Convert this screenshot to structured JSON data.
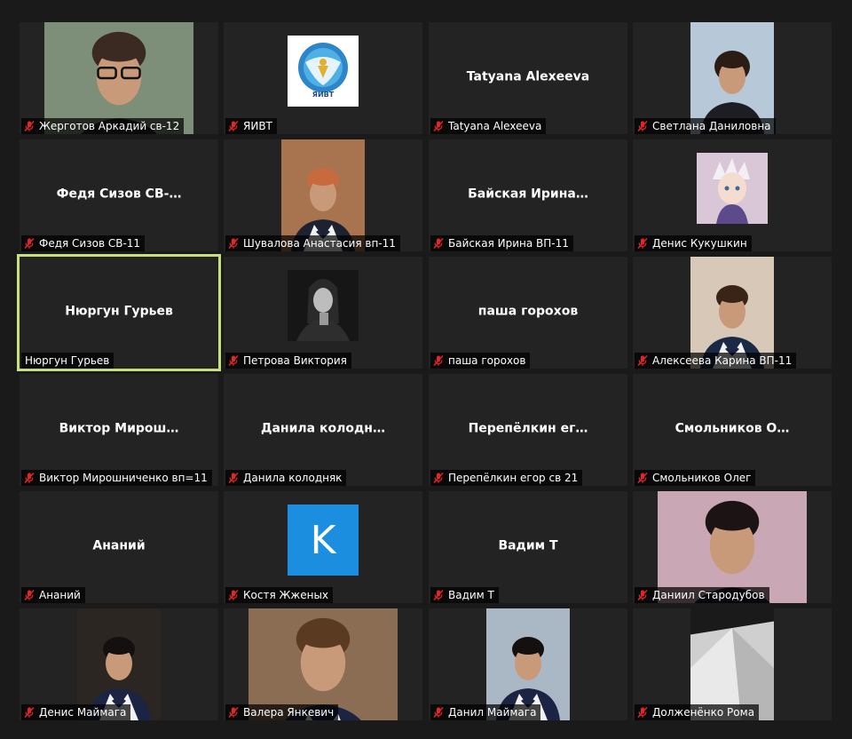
{
  "colors": {
    "background": "#1a1a1a",
    "tile": "#232323",
    "active_border": "#c7e07f",
    "muted_mic": "#e02828",
    "avatar_blue": "#1b8ee0"
  },
  "participants": [
    {
      "label": "Жерготов Аркадий св-12",
      "muted": true,
      "video": "person-glasses"
    },
    {
      "label": "ЯИВТ",
      "muted": true,
      "video": "logo-emblem",
      "logo_text": "ЯИВТ"
    },
    {
      "label": "Tatyana Alexeeva",
      "muted": true,
      "display": "Tatyana Alexeeva"
    },
    {
      "label": "Светлана Даниловна",
      "muted": true,
      "video": "person-woman"
    },
    {
      "label": "Федя Сизов СВ-11",
      "muted": true,
      "display": "Федя  Сизов  СВ-…"
    },
    {
      "label": "Шувалова Анастасия вп-11",
      "muted": true,
      "video": "person-girl"
    },
    {
      "label": "Байская Ирина ВП-11",
      "muted": true,
      "display": "Байская  Ирина…"
    },
    {
      "label": "Денис Кукушкин",
      "muted": true,
      "video": "anime-avatar"
    },
    {
      "label": "Нюргун Гурьев",
      "muted": false,
      "active": true,
      "display": "Нюргун Гурьев"
    },
    {
      "label": "Петрова Виктория",
      "muted": true,
      "video": "dark-portrait"
    },
    {
      "label": "паша горохов",
      "muted": true,
      "display": "паша горохов"
    },
    {
      "label": "Алексеева Карина ВП-11",
      "muted": true,
      "video": "person-girl-2"
    },
    {
      "label": "Виктор Мирошниченко вп=11",
      "muted": true,
      "display": "Виктор  Мирош…"
    },
    {
      "label": "Данила колодняк",
      "muted": true,
      "display": "Данила  колодн…"
    },
    {
      "label": "Перепёлкин егор св 21",
      "muted": true,
      "display": "Перепёлкин  ег…"
    },
    {
      "label": "Смольников Олег",
      "muted": true,
      "display": "Смольников  О…"
    },
    {
      "label": "Ананий",
      "muted": true,
      "display": "Ананий"
    },
    {
      "label": "Костя Жженых",
      "muted": true,
      "video": "letter-avatar",
      "avatar_letter": "K"
    },
    {
      "label": " Вадим Т",
      "muted": true,
      "display": "Вадим Т"
    },
    {
      "label": "Даниил Стародубов",
      "muted": true,
      "video": "person-boy"
    },
    {
      "label": "Денис Маймага",
      "muted": true,
      "video": "person-sailor"
    },
    {
      "label": "Валера Янкевич",
      "muted": true,
      "video": "person-sailor-2"
    },
    {
      "label": "Данил Маймага",
      "muted": true,
      "video": "person-sailor-3"
    },
    {
      "label": "Долженёнко Рома",
      "muted": true,
      "video": "ceiling-view"
    }
  ]
}
